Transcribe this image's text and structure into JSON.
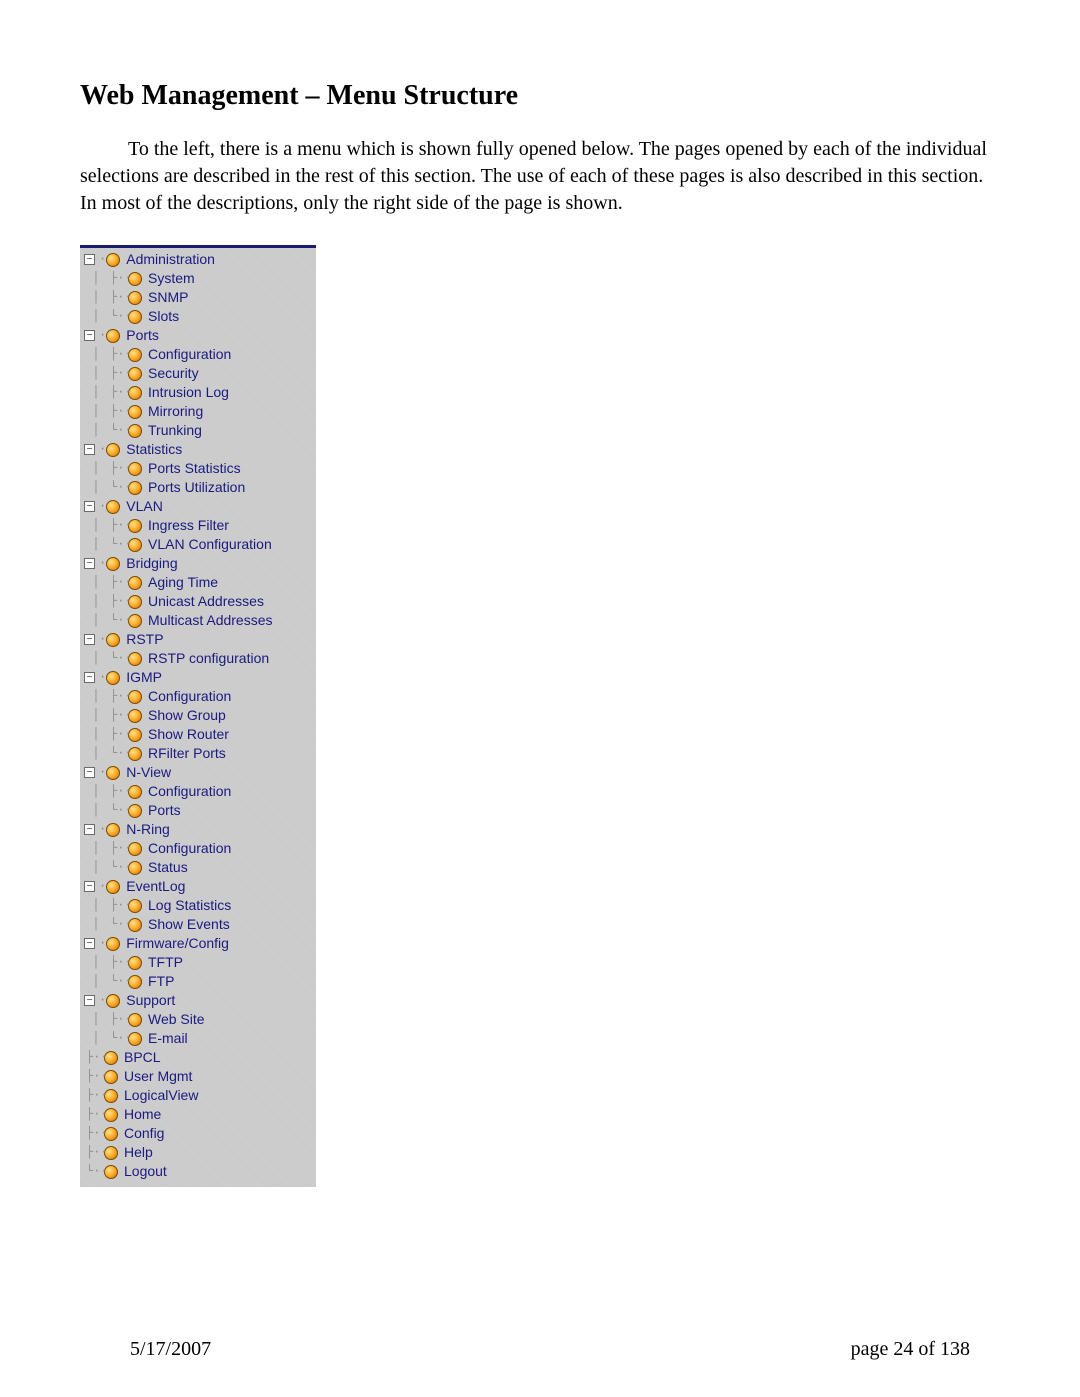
{
  "title": "Web Management – Menu Structure",
  "intro": "To the left, there is a menu which is shown fully opened below.  The pages opened by each of the individual selections are described in the rest of this section.  The use of each of these pages is also described in this section.  In most of the descriptions, only the right side of the page is shown.",
  "footer": {
    "date": "5/17/2007",
    "page": "page 24 of 138"
  },
  "glyphs": {
    "minus": "−",
    "dots": "···",
    "tee": "├··",
    "ell": "└··",
    "bar": "│"
  },
  "menu": {
    "sections": [
      {
        "label": "Administration",
        "expandable": true,
        "children": [
          {
            "label": "System",
            "last": false
          },
          {
            "label": "SNMP",
            "last": false
          },
          {
            "label": "Slots",
            "last": true
          }
        ]
      },
      {
        "label": "Ports",
        "expandable": true,
        "children": [
          {
            "label": "Configuration",
            "last": false
          },
          {
            "label": "Security",
            "last": false
          },
          {
            "label": "Intrusion Log",
            "last": false
          },
          {
            "label": "Mirroring",
            "last": false
          },
          {
            "label": "Trunking",
            "last": true
          }
        ]
      },
      {
        "label": "Statistics",
        "expandable": true,
        "children": [
          {
            "label": "Ports Statistics",
            "last": false
          },
          {
            "label": "Ports Utilization",
            "last": true
          }
        ]
      },
      {
        "label": "VLAN",
        "expandable": true,
        "children": [
          {
            "label": "Ingress Filter",
            "last": false
          },
          {
            "label": "VLAN Configuration",
            "last": true
          }
        ]
      },
      {
        "label": "Bridging",
        "expandable": true,
        "children": [
          {
            "label": "Aging Time",
            "last": false
          },
          {
            "label": "Unicast Addresses",
            "last": false
          },
          {
            "label": "Multicast Addresses",
            "last": true
          }
        ]
      },
      {
        "label": "RSTP",
        "expandable": true,
        "children": [
          {
            "label": "RSTP configuration",
            "last": true
          }
        ]
      },
      {
        "label": "IGMP",
        "expandable": true,
        "children": [
          {
            "label": "Configuration",
            "last": false
          },
          {
            "label": "Show Group",
            "last": false
          },
          {
            "label": "Show Router",
            "last": false
          },
          {
            "label": "RFilter Ports",
            "last": true
          }
        ]
      },
      {
        "label": "N-View",
        "expandable": true,
        "children": [
          {
            "label": "Configuration",
            "last": false
          },
          {
            "label": "Ports",
            "last": true
          }
        ]
      },
      {
        "label": "N-Ring",
        "expandable": true,
        "children": [
          {
            "label": "Configuration",
            "last": false
          },
          {
            "label": "Status",
            "last": true
          }
        ]
      },
      {
        "label": "EventLog",
        "expandable": true,
        "children": [
          {
            "label": "Log Statistics",
            "last": false
          },
          {
            "label": "Show Events",
            "last": true
          }
        ]
      },
      {
        "label": "Firmware/Config",
        "expandable": true,
        "children": [
          {
            "label": "TFTP",
            "last": false
          },
          {
            "label": "FTP",
            "last": true
          }
        ]
      },
      {
        "label": "Support",
        "expandable": true,
        "children": [
          {
            "label": "Web Site",
            "last": false
          },
          {
            "label": "E-mail",
            "last": true
          }
        ]
      },
      {
        "label": "BPCL",
        "expandable": false,
        "top": false
      },
      {
        "label": "User Mgmt",
        "expandable": false,
        "top": false
      },
      {
        "label": "LogicalView",
        "expandable": false,
        "top": false
      },
      {
        "label": "Home",
        "expandable": false,
        "top": false
      },
      {
        "label": "Config",
        "expandable": false,
        "top": false
      },
      {
        "label": "Help",
        "expandable": false,
        "top": false
      },
      {
        "label": "Logout",
        "expandable": false,
        "top": false,
        "last": true
      }
    ]
  }
}
